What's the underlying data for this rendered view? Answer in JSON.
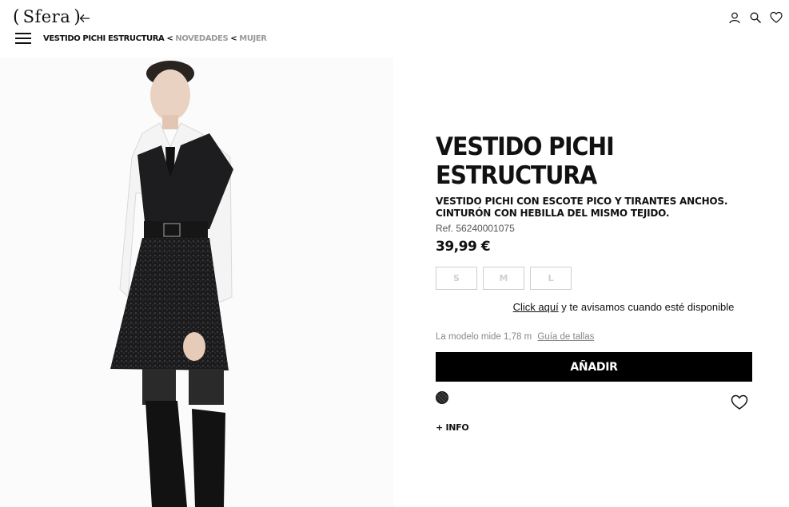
{
  "header": {
    "logo_text": "Sfera",
    "logo_paren_open": "(",
    "logo_paren_close": ")",
    "icons": [
      "back-arrow-icon",
      "user-icon",
      "search-icon",
      "heart-icon"
    ]
  },
  "breadcrumb": {
    "current": "VESTIDO PICHI ESTRUCTURA",
    "separator": "<",
    "items": [
      "NOVEDADES",
      "MUJER"
    ]
  },
  "product": {
    "title": "VESTIDO PICHI ESTRUCTURA",
    "description": "VESTIDO PICHI CON ESCOTE PICO Y TIRANTES ANCHOS. CINTURÓN CON HEBILLA DEL MISMO TEJIDO.",
    "ref": "Ref. 56240001075",
    "price": "39,99 €",
    "sizes": [
      "S",
      "M",
      "L"
    ],
    "notify_link": "Click aquí",
    "notify_text": " y te avisamos cuando esté disponible",
    "model_info": "La modelo mide 1,78 m",
    "size_guide": "Guía de tallas",
    "add_button": "AÑADIR",
    "more_info": "+ INFO",
    "swatch_color": "#1f1f1f",
    "accent_color": "#000000"
  }
}
